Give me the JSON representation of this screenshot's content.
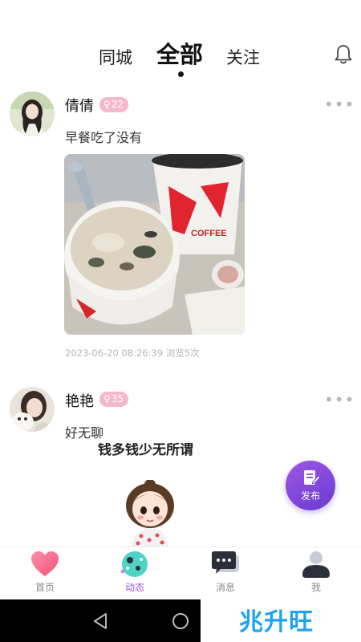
{
  "tabs": {
    "nearby": "同城",
    "all": "全部",
    "follow": "关注"
  },
  "posts": [
    {
      "name": "倩倩",
      "age_badge": "22",
      "text": "早餐吃了没有",
      "meta": "2023-06-20 08:26:39  浏览5次"
    },
    {
      "name": "艳艳",
      "age_badge": "35",
      "text": "好无聊",
      "image_caption": "钱多钱少无所谓"
    }
  ],
  "photo_labels": {
    "brand": "COFFEE"
  },
  "fab": {
    "label": "发布"
  },
  "nav": [
    {
      "label": "首页"
    },
    {
      "label": "动态"
    },
    {
      "label": "消息"
    },
    {
      "label": "我"
    }
  ],
  "watermark": "兆升旺",
  "colors": {
    "accent": "#9c5ae0",
    "badge": "#f6b6cb",
    "fab": "#7f48dc"
  }
}
